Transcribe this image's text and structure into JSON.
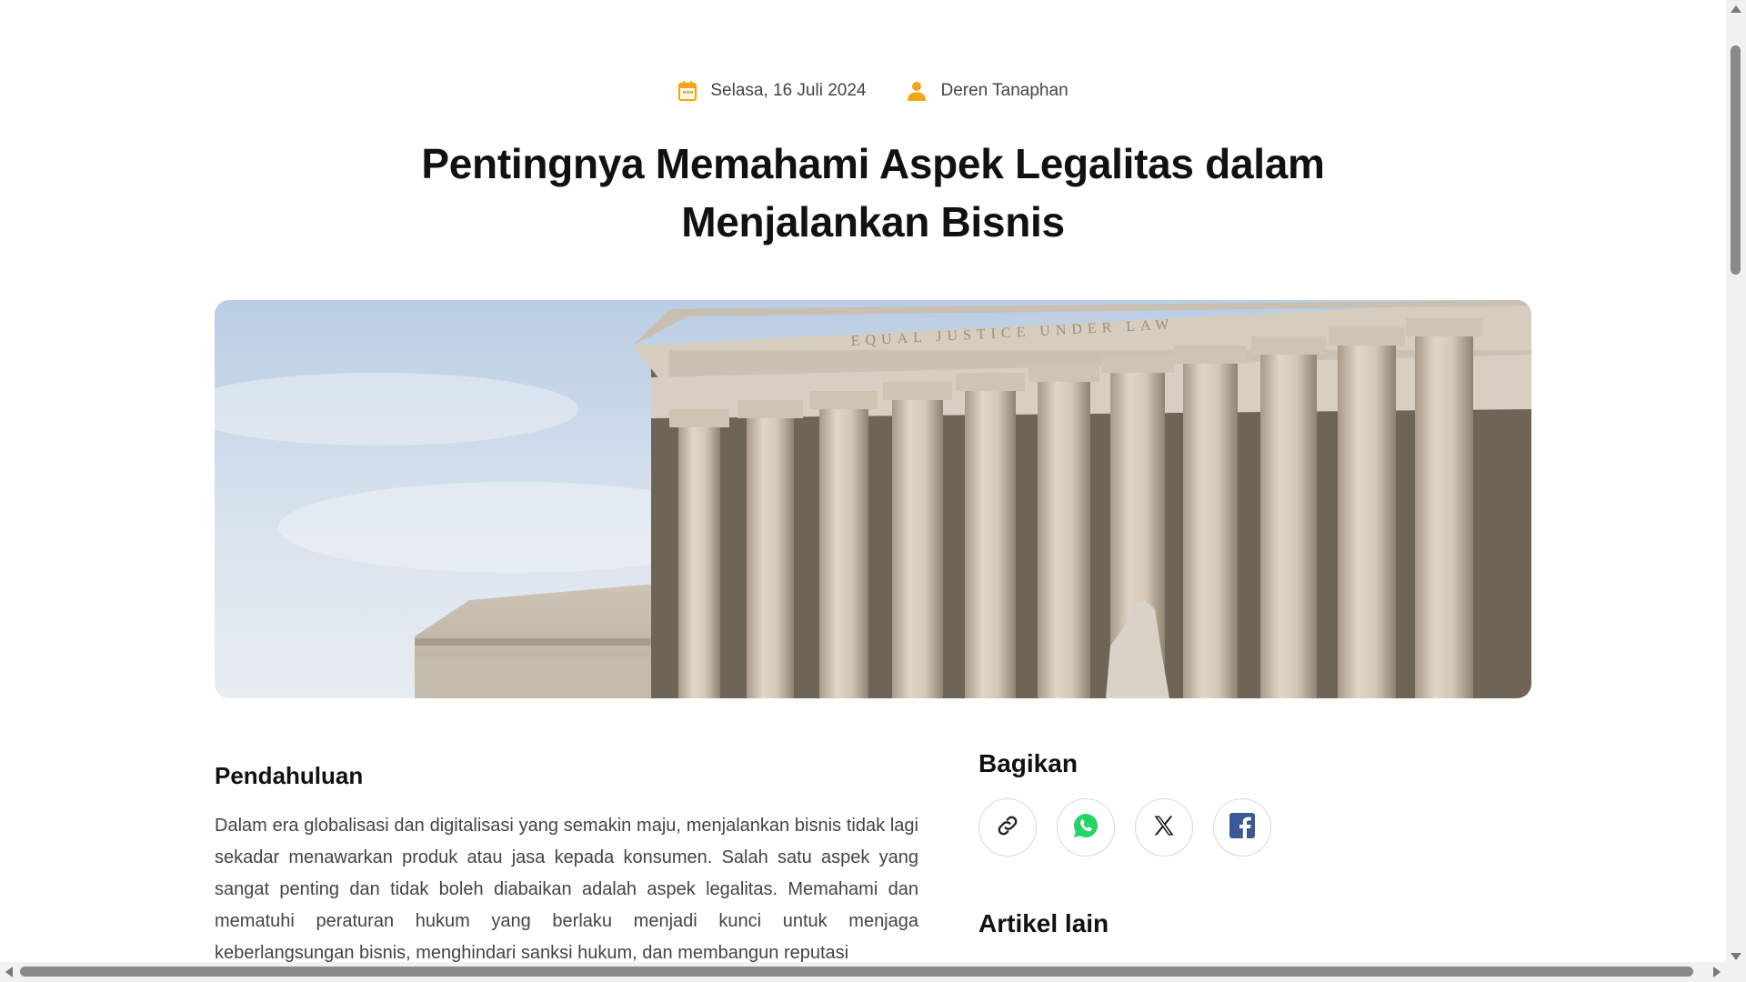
{
  "meta": {
    "date": "Selasa, 16 Juli 2024",
    "author": "Deren Tanaphan",
    "icon_color": "#f2a516"
  },
  "title": "Pentingnya Memahami Aspek Legalitas dalam Menjalankan Bisnis",
  "hero": {
    "icon": "courthouse-photo",
    "inscription": "EQUAL JUSTICE UNDER LAW"
  },
  "article": {
    "heading": "Pendahuluan",
    "paragraph": "Dalam era globalisasi dan digitalisasi yang semakin maju, menjalankan bisnis tidak lagi sekadar menawarkan produk atau jasa kepada konsumen. Salah satu aspek yang sangat penting dan tidak boleh diabaikan adalah aspek legalitas. Memahami dan mematuhi peraturan hukum yang berlaku menjadi kunci untuk menjaga keberlangsungan bisnis, menghindari sanksi hukum, dan membangun reputasi"
  },
  "aside": {
    "share_heading": "Bagikan",
    "share_buttons": [
      "link-icon",
      "whatsapp-icon",
      "x-icon",
      "facebook-icon"
    ],
    "other_heading": "Artikel lain"
  },
  "colors": {
    "whatsapp": "#25d366",
    "facebook": "#3b5998",
    "text": "#444444"
  }
}
